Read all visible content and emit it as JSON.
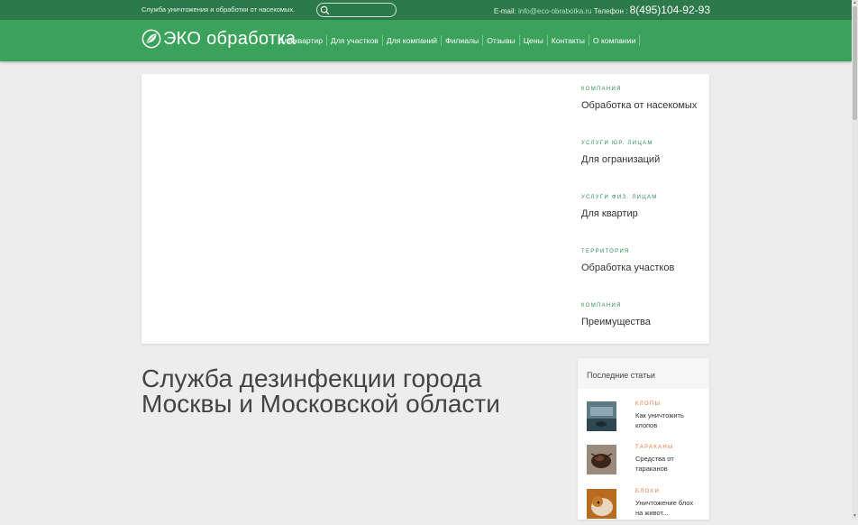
{
  "topbar": {
    "tagline": "Служба уничтожения и обработки от насекомых.",
    "search_placeholder": "",
    "email_label": "E-mail:",
    "email": "info@eco-obrabotka.ru",
    "phone_label": "Телефон :",
    "phone": "8(495)104-92-93"
  },
  "logo": {
    "text": "ЭКО обработка"
  },
  "menu": [
    {
      "label": "Для квартир"
    },
    {
      "label": "Для участков"
    },
    {
      "label": "Для компаний"
    },
    {
      "label": "Филиалы"
    },
    {
      "label": "Отзывы"
    },
    {
      "label": "Цены"
    },
    {
      "label": "Контакты"
    },
    {
      "label": "О компании"
    }
  ],
  "slides": [
    {
      "category": "Компания",
      "title": "Обработка от насекомых"
    },
    {
      "category": "Услуги юр. лицам",
      "title": "Для огранизаций"
    },
    {
      "category": "Услуги физ. лицам",
      "title": "Для квартир"
    },
    {
      "category": "Территория",
      "title": "Обработка участков"
    },
    {
      "category": "Компания",
      "title": "Преимущества"
    }
  ],
  "main": {
    "heading": "Служба дезинфекции города Москвы и Московской области"
  },
  "recent": {
    "title": "Последние статьи",
    "articles": [
      {
        "category": "Клопы",
        "title": "Как уничтожить клопов"
      },
      {
        "category": "Тараканы",
        "title": "Средства от тараканов"
      },
      {
        "category": "Блохи",
        "title": "Уничтожение блох на живот..."
      }
    ]
  },
  "colors": {
    "topbar": "#2c7a4a",
    "navbar": "#3aa25a",
    "accent_green": "#2c8d4c",
    "accent_orange": "#e07a3a"
  },
  "icons": {
    "search": "search-icon",
    "logo": "leaf-logo-icon"
  }
}
